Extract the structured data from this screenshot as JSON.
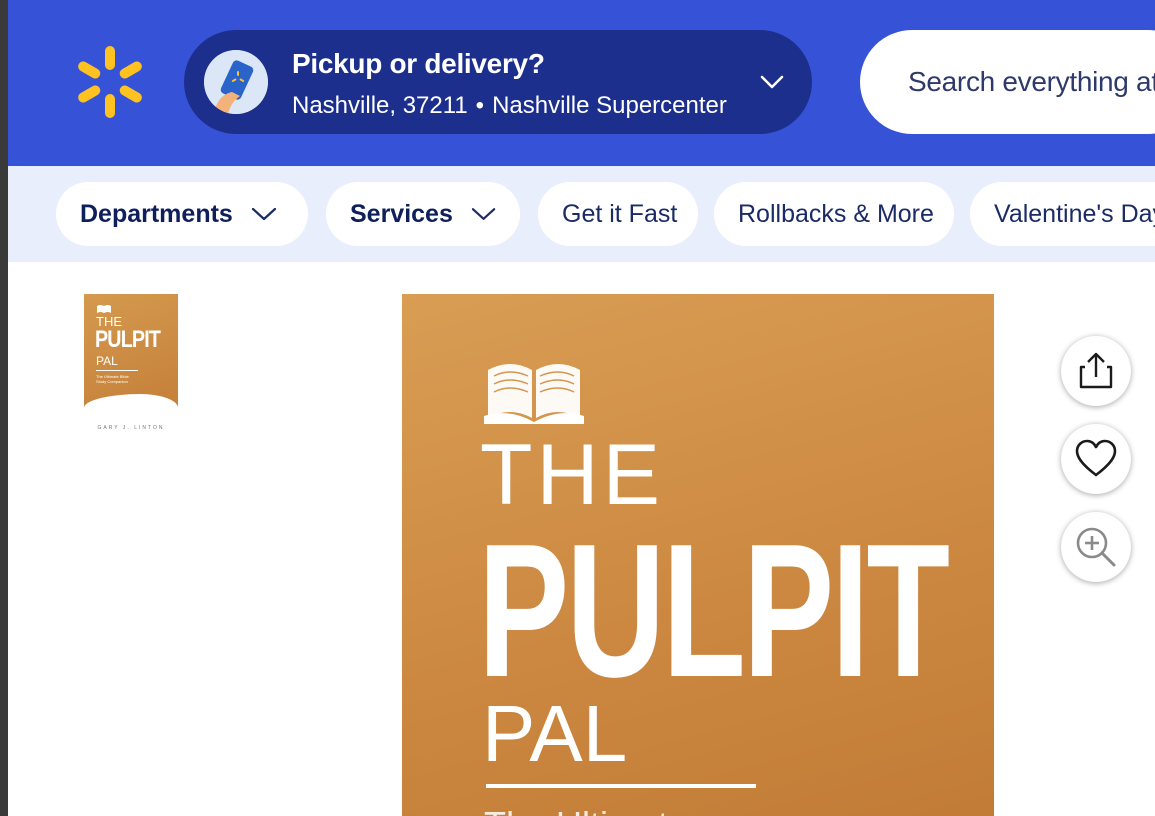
{
  "header": {
    "location": {
      "title": "Pickup or delivery?",
      "city": "Nashville, 37211",
      "separator": "•",
      "store": "Nashville Supercenter"
    },
    "search": {
      "placeholder": "Search everything at"
    },
    "colors": {
      "header_bg": "#3653d7",
      "location_bg": "#1d2f8c",
      "spark_yellow": "#ffc220"
    }
  },
  "nav": {
    "items": [
      {
        "label": "Departments",
        "has_dropdown": true
      },
      {
        "label": "Services",
        "has_dropdown": true
      },
      {
        "label": "Get it Fast",
        "has_dropdown": false
      },
      {
        "label": "Rollbacks & More",
        "has_dropdown": false
      },
      {
        "label": "Valentine's Day",
        "has_dropdown": false
      }
    ]
  },
  "product": {
    "thumbnail": {
      "title_small": "THE",
      "title_big": "PULPIT",
      "title_pal": "PAL",
      "subtitle": "The Ultimate Bible Study Companion",
      "author": "GARY J. LINTON"
    },
    "cover": {
      "the": "THE",
      "pulpit": "PULPIT",
      "pal": "PAL",
      "subtitle_partial": "The Ultimate"
    },
    "actions": [
      {
        "icon": "share-icon"
      },
      {
        "icon": "heart-icon"
      },
      {
        "icon": "zoom-in-icon"
      }
    ]
  }
}
